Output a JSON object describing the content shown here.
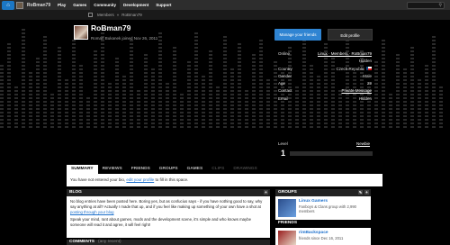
{
  "topbar": {
    "logo": "⌂",
    "username": "RoBman79",
    "nav": [
      "Play",
      "Games",
      "Community",
      "Development",
      "Support"
    ],
    "active_nav": "Community"
  },
  "breadcrumb": [
    "Members",
    "»",
    "RoBman79"
  ],
  "profile": {
    "name": "RoBman79",
    "subtitle": "Roman Bukanek joined Nov 26, 2011",
    "manage_friends_label": "Manage your friends",
    "edit_profile_label": "Edit profile"
  },
  "info": [
    {
      "key": "Online",
      "value": "Linux · Members · RoBman79",
      "link": true
    },
    {
      "key": "",
      "value": "Hidden",
      "link": false
    },
    {
      "key": "Country",
      "value": "Czech Republic",
      "link": false,
      "flag": true
    },
    {
      "key": "Gender",
      "value": "Male",
      "link": false
    },
    {
      "key": "Age",
      "value": "29",
      "link": false
    },
    {
      "key": "Contact",
      "value": "Private Message",
      "link": true
    },
    {
      "key": "Email",
      "value": "Hidden",
      "link": false
    }
  ],
  "level": {
    "label": "Level",
    "value": "1",
    "rank": "Newbie"
  },
  "tabs": [
    {
      "label": "SUMMARY",
      "state": "active"
    },
    {
      "label": "REVIEWS",
      "state": "normal"
    },
    {
      "label": "FRIENDS",
      "state": "normal"
    },
    {
      "label": "GROUPS",
      "state": "normal"
    },
    {
      "label": "GAMES",
      "state": "normal"
    },
    {
      "label": "CLIPS",
      "state": "dim"
    },
    {
      "label": "DRAWINGS",
      "state": "dim"
    }
  ],
  "summary": {
    "text_before": "You have not entered your bio,",
    "link": "edit your profile",
    "text_after": "to fill in this space."
  },
  "blog": {
    "heading": "BLOG",
    "p1": "No blog entries have been posted here. Boring yes, but as confucius says - if you have nothing good to say, why say anything at all? Actually I made that up, and if you feel like making up something of your own have a shot at",
    "p1_link": "posting through your blog",
    "p2": "Speak your mind, rant about games, mods and the development scene, it's simple and who knows maybe someone will read it and agree, it will feel right!"
  },
  "comments": {
    "heading": "COMMENTS",
    "sub": "(any recent)"
  },
  "groups": {
    "heading": "GROUPS",
    "title": "Linux Gamers",
    "desc": "Fanboys & Clans group with 2,990 members"
  },
  "friends": {
    "heading": "FRIENDS",
    "title": "rimBackspace",
    "desc": "friends since Dec 16, 2011"
  },
  "colors": {
    "accent": "#2f84d2",
    "link": "#1b6fcc"
  }
}
